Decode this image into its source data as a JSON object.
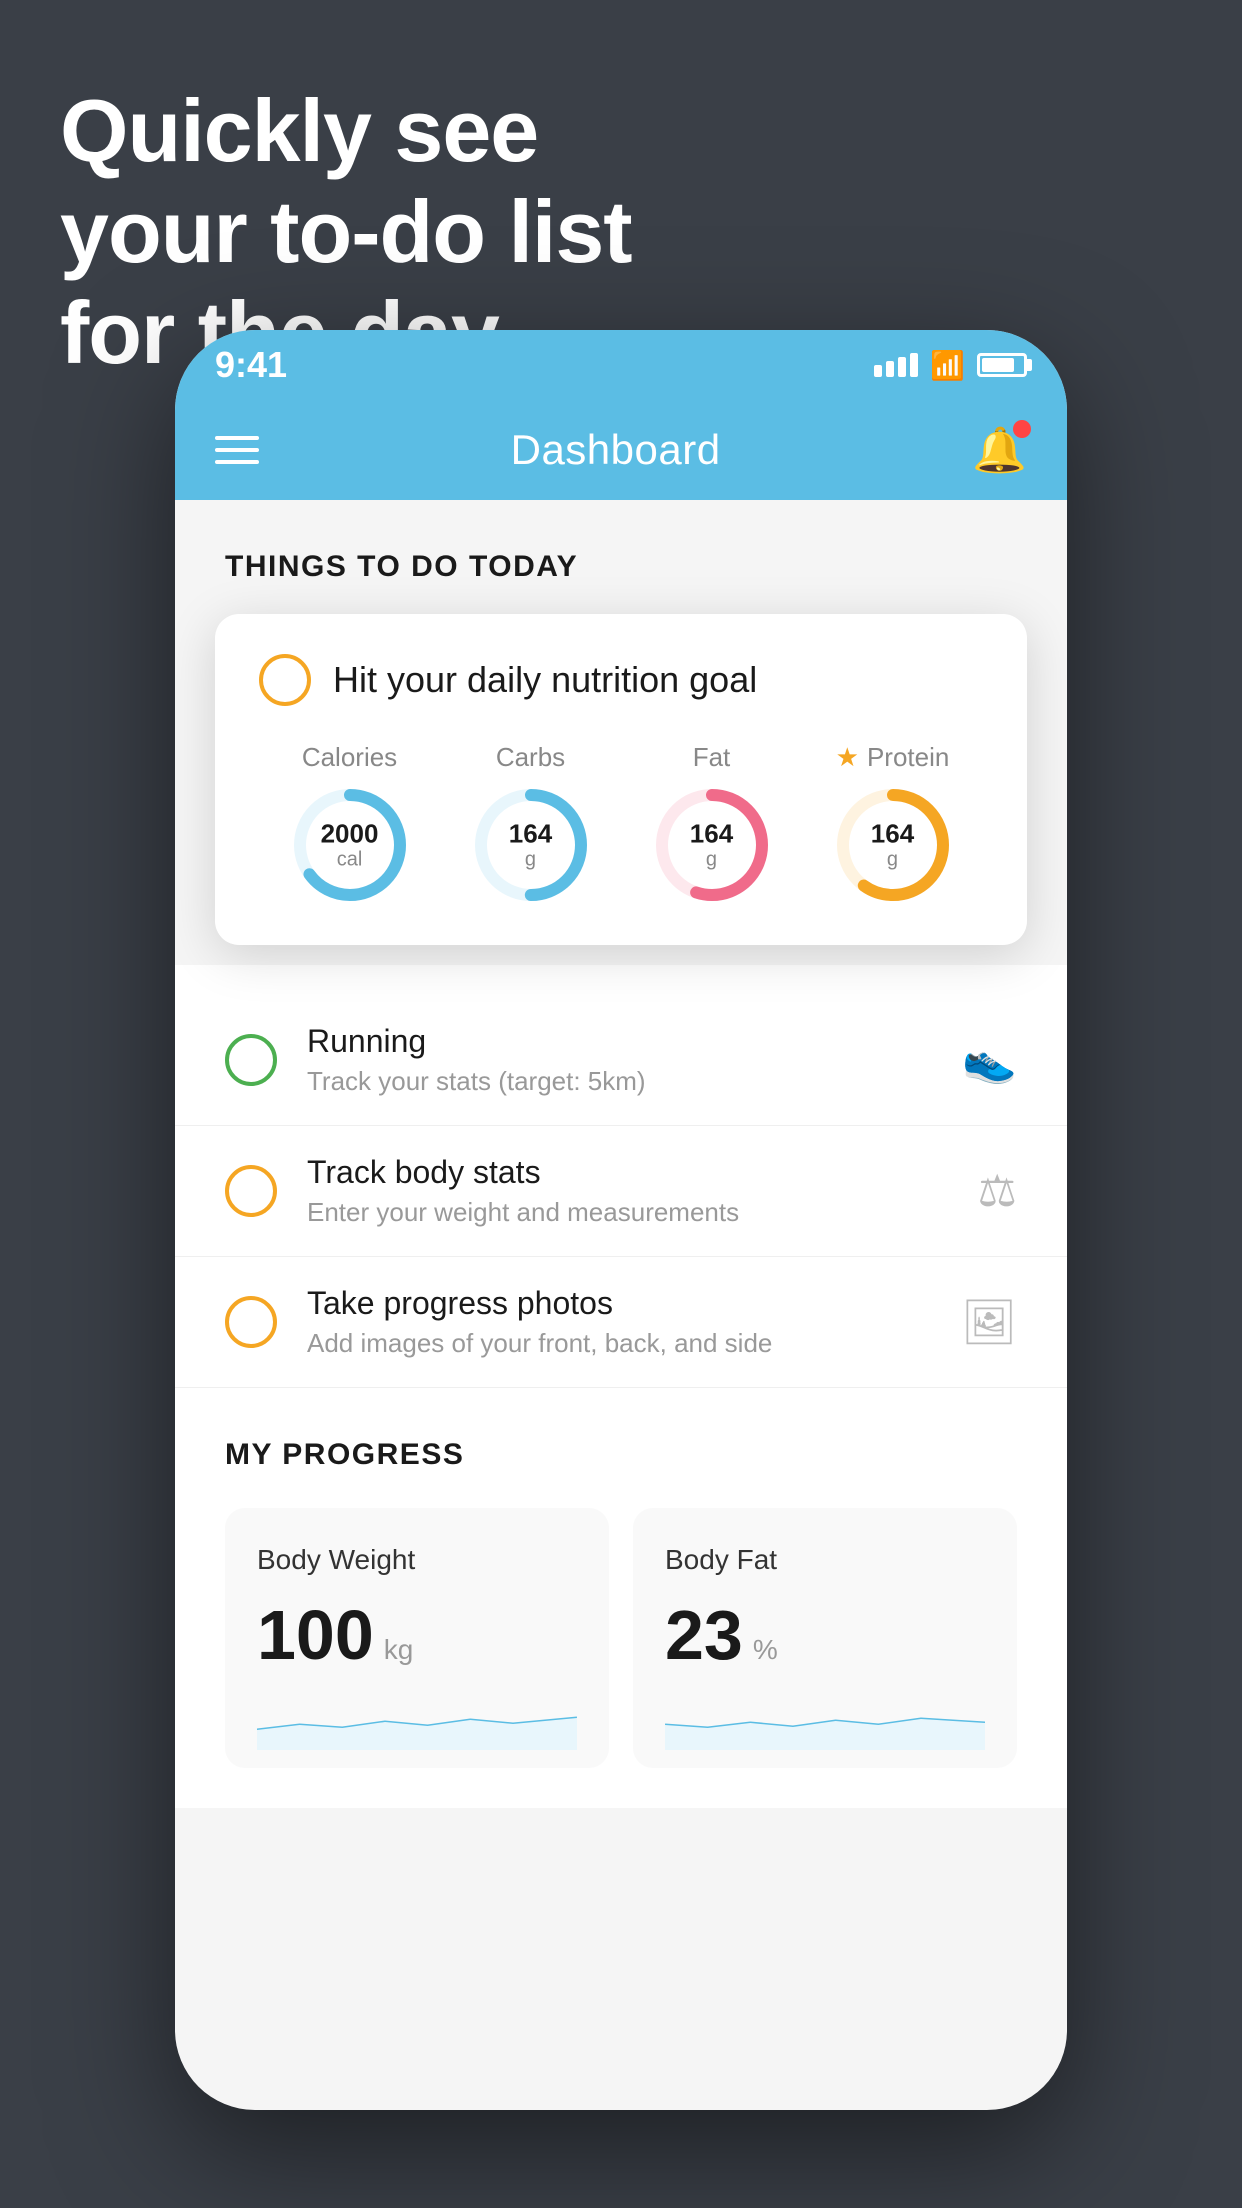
{
  "hero": {
    "line1": "Quickly see",
    "line2": "your to-do list",
    "line3": "for the day."
  },
  "statusBar": {
    "time": "9:41"
  },
  "header": {
    "title": "Dashboard"
  },
  "sectionToday": {
    "label": "THINGS TO DO TODAY"
  },
  "nutritionCard": {
    "checkLabel": "",
    "title": "Hit your daily nutrition goal",
    "macros": [
      {
        "label": "Calories",
        "value": "2000",
        "unit": "cal",
        "color": "#5bbde4",
        "bgColor": "#e8f6fc",
        "star": false,
        "pct": 65
      },
      {
        "label": "Carbs",
        "value": "164",
        "unit": "g",
        "color": "#5bbde4",
        "bgColor": "#e8f6fc",
        "star": false,
        "pct": 50
      },
      {
        "label": "Fat",
        "value": "164",
        "unit": "g",
        "color": "#f06b8a",
        "bgColor": "#fde8ed",
        "star": false,
        "pct": 55
      },
      {
        "label": "Protein",
        "value": "164",
        "unit": "g",
        "color": "#f5a623",
        "bgColor": "#fef3e0",
        "star": true,
        "pct": 60
      }
    ]
  },
  "todoItems": [
    {
      "type": "green",
      "title": "Running",
      "subtitle": "Track your stats (target: 5km)",
      "icon": "shoe"
    },
    {
      "type": "yellow",
      "title": "Track body stats",
      "subtitle": "Enter your weight and measurements",
      "icon": "scale"
    },
    {
      "type": "yellow",
      "title": "Take progress photos",
      "subtitle": "Add images of your front, back, and side",
      "icon": "photo"
    }
  ],
  "progressSection": {
    "title": "MY PROGRESS",
    "cards": [
      {
        "label": "Body Weight",
        "value": "100",
        "unit": "kg"
      },
      {
        "label": "Body Fat",
        "value": "23",
        "unit": "%"
      }
    ]
  }
}
